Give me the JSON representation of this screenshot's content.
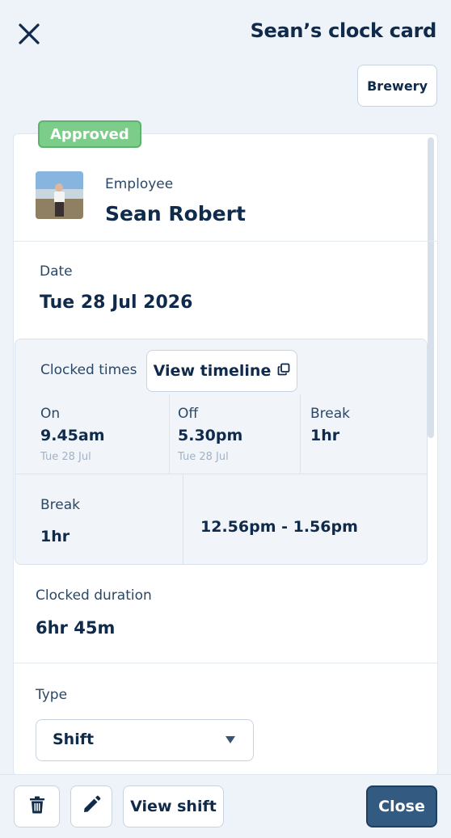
{
  "header": {
    "title": "Sean’s clock card",
    "location_button": "Brewery"
  },
  "status": {
    "badge": "Approved"
  },
  "employee": {
    "label": "Employee",
    "name": "Sean Robert"
  },
  "date": {
    "label": "Date",
    "value": "Tue 28 Jul 2026"
  },
  "clocked": {
    "label": "Clocked times",
    "timeline_button": "View timeline",
    "on": {
      "label": "On",
      "time": "9.45am",
      "date": "Tue 28 Jul"
    },
    "off": {
      "label": "Off",
      "time": "5.30pm",
      "date": "Tue 28 Jul"
    },
    "break": {
      "label": "Break",
      "value": "1hr"
    },
    "break_detail": {
      "label": "Break",
      "value": "1hr",
      "range": "12.56pm - 1.56pm"
    }
  },
  "duration": {
    "label": "Clocked duration",
    "value": "6hr 45m"
  },
  "type": {
    "label": "Type",
    "value": "Shift"
  },
  "footer": {
    "view_shift": "View shift",
    "close": "Close"
  },
  "icons": {
    "close": "close-icon",
    "timeline": "external-window-icon",
    "delete": "trash-icon",
    "edit": "pencil-icon",
    "dropdown": "caret-down-icon"
  },
  "colors": {
    "primary": "#335b82",
    "approved": "#7ccc8a",
    "text": "#0f2a4a",
    "background": "#eef3fa"
  }
}
